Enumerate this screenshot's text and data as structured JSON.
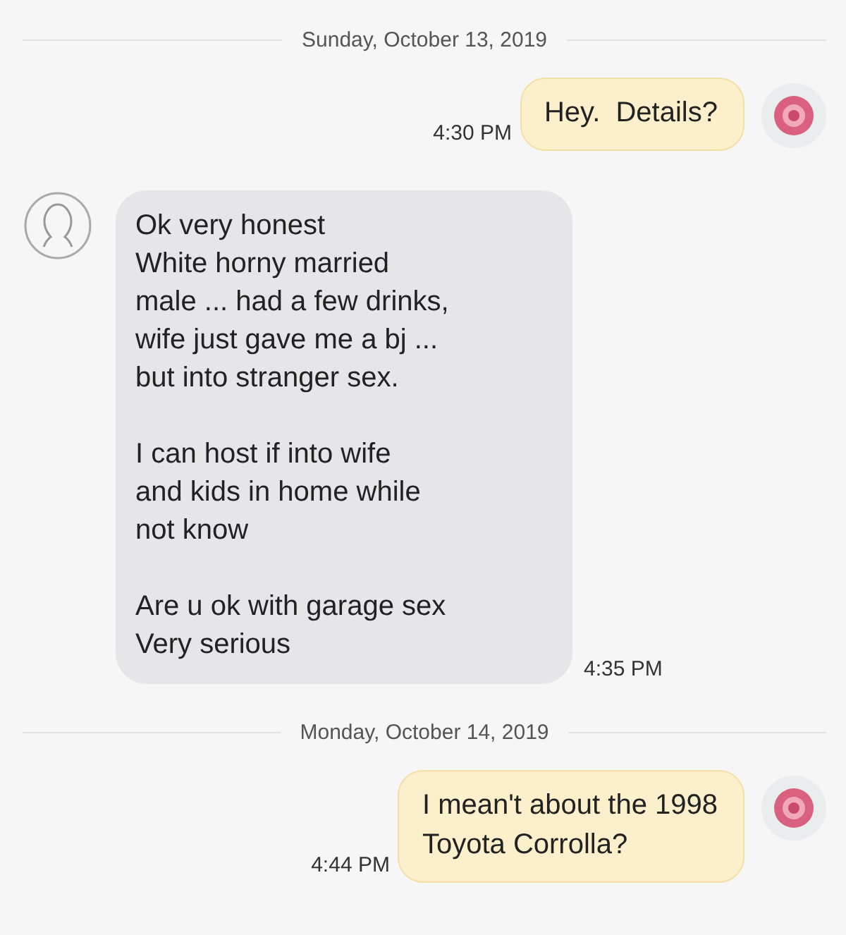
{
  "messages": [
    {
      "kind": "date",
      "text": "Sunday, October 13, 2019"
    },
    {
      "kind": "sent",
      "time": "4:30 PM",
      "paragraphs": [
        [
          "Hey.  Details?"
        ]
      ]
    },
    {
      "kind": "received",
      "time": "4:35 PM",
      "paragraphs": [
        [
          "Ok very honest",
          "White horny married",
          "male ... had a few drinks,",
          "wife just gave me a bj ...",
          "but into stranger sex."
        ],
        [
          "I can host if into wife",
          "and kids in home while",
          "not know"
        ],
        [
          "Are u ok with garage sex",
          "Very serious"
        ]
      ]
    },
    {
      "kind": "date",
      "text": "Monday, October 14, 2019"
    },
    {
      "kind": "sent",
      "time": "4:44 PM",
      "paragraphs": [
        [
          "I mean't about the 1998",
          "Toyota Corrolla?"
        ]
      ]
    }
  ]
}
